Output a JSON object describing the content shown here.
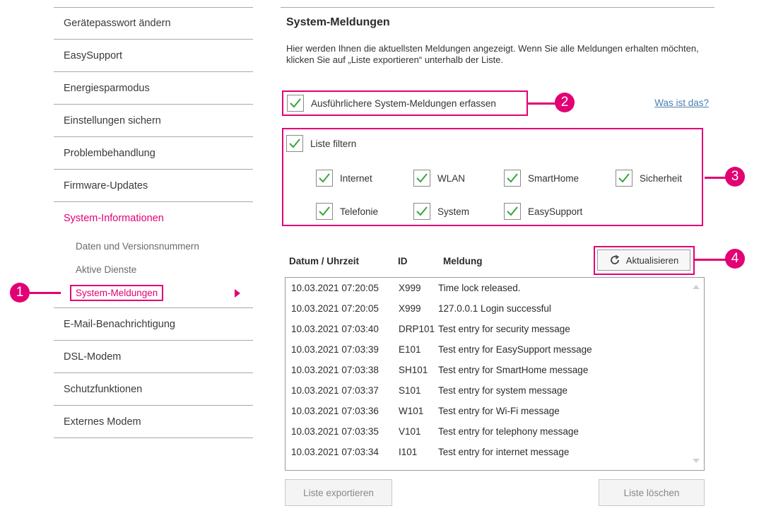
{
  "sidebar": {
    "items": [
      {
        "label": "Gerätepasswort ändern"
      },
      {
        "label": "EasySupport"
      },
      {
        "label": "Energiesparmodus"
      },
      {
        "label": "Einstellungen sichern"
      },
      {
        "label": "Problembehandlung"
      },
      {
        "label": "Firmware-Updates"
      }
    ],
    "active_group": "System-Informationen",
    "sub_items": [
      {
        "label": "Daten und Versionsnummern"
      },
      {
        "label": "Aktive Dienste"
      },
      {
        "label": "System-Meldungen"
      }
    ],
    "items_after": [
      {
        "label": "E-Mail-Benachrichtigung"
      },
      {
        "label": "DSL-Modem"
      },
      {
        "label": "Schutzfunktionen"
      },
      {
        "label": "Externes Modem"
      }
    ]
  },
  "callouts": {
    "c1": "1",
    "c2": "2",
    "c3": "3",
    "c4": "4"
  },
  "main": {
    "title": "System-Meldungen",
    "intro": "Hier werden Ihnen die aktuellsten Meldungen angezeigt. Wenn Sie alle Meldungen erhalten möchten, klicken Sie auf „Liste exportieren“ unterhalb der Liste.",
    "verbose_label": "Ausführlichere System-Meldungen erfassen",
    "what_link": "Was ist das?",
    "filter_label": "Liste filtern",
    "filters": [
      "Internet",
      "WLAN",
      "SmartHome",
      "Sicherheit",
      "Telefonie",
      "System",
      "EasySupport"
    ],
    "table_headers": {
      "date": "Datum / Uhrzeit",
      "id": "ID",
      "message": "Meldung"
    },
    "refresh_label": "Aktualisieren",
    "log": [
      {
        "date": "10.03.2021 07:20:05",
        "id": "X999",
        "msg": "Time lock released."
      },
      {
        "date": "10.03.2021 07:20:05",
        "id": "X999",
        "msg": "127.0.0.1 Login successful"
      },
      {
        "date": "10.03.2021 07:03:40",
        "id": "DRP101",
        "msg": "Test entry for security message"
      },
      {
        "date": "10.03.2021 07:03:39",
        "id": "E101",
        "msg": "Test entry for EasySupport message"
      },
      {
        "date": "10.03.2021 07:03:38",
        "id": "SH101",
        "msg": "Test entry for SmartHome message"
      },
      {
        "date": "10.03.2021 07:03:37",
        "id": "S101",
        "msg": "Test entry for system message"
      },
      {
        "date": "10.03.2021 07:03:36",
        "id": "W101",
        "msg": "Test entry for Wi-Fi message"
      },
      {
        "date": "10.03.2021 07:03:35",
        "id": "V101",
        "msg": "Test entry for telephony message"
      },
      {
        "date": "10.03.2021 07:03:34",
        "id": "I101",
        "msg": "Test entry for internet message"
      }
    ],
    "export_label": "Liste exportieren",
    "clear_label": "Liste löschen"
  },
  "colors": {
    "accent": "#e20074",
    "check": "#3aa43a",
    "link": "#4a7fb0"
  }
}
